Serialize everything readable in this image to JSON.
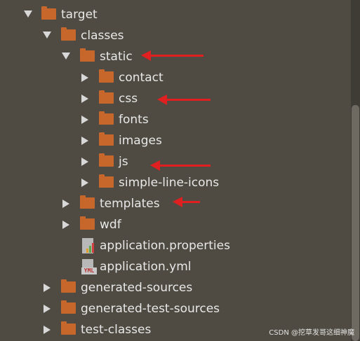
{
  "tree": {
    "target": "target",
    "classes": "classes",
    "static": "static",
    "contact": "contact",
    "css": "css",
    "fonts": "fonts",
    "images": "images",
    "js": "js",
    "simple_line_icons": "simple-line-icons",
    "templates": "templates",
    "wdf": "wdf",
    "application_properties": "application.properties",
    "application_yml": "application.yml",
    "generated_sources": "generated-sources",
    "generated_test_sources": "generated-test-sources",
    "test_classes": "test-classes"
  },
  "icons": {
    "folder": "folder-icon",
    "properties_file": "properties-file-icon",
    "yml_file": "yml-file-icon",
    "yml_badge_text": "YML"
  },
  "colors": {
    "background": "#4f4b42",
    "folder": "#c8672b",
    "annotation_arrow": "#e02020"
  },
  "watermark": "CSDN @挖草发哥这细神魔"
}
